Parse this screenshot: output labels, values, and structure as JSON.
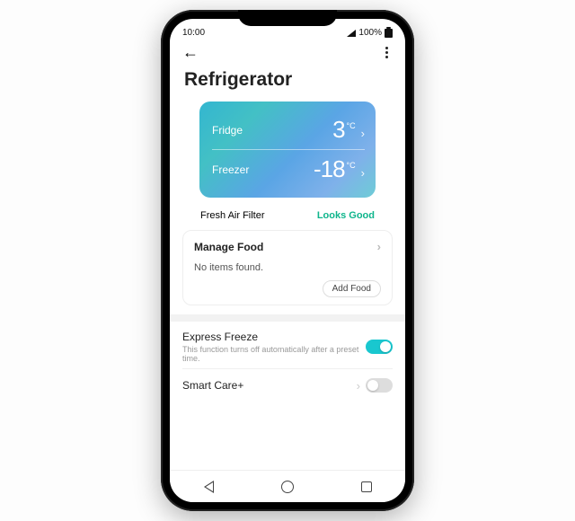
{
  "status": {
    "time": "10:00",
    "battery_pct": "100%"
  },
  "page": {
    "title": "Refrigerator"
  },
  "temps": {
    "fridge_label": "Fridge",
    "fridge_value": "3",
    "fridge_unit": "°C",
    "freezer_label": "Freezer",
    "freezer_value": "-18",
    "freezer_unit": "°C"
  },
  "filter": {
    "label": "Fresh Air Filter",
    "status": "Looks Good"
  },
  "food": {
    "heading": "Manage Food",
    "empty_text": "No items found.",
    "add_label": "Add Food"
  },
  "settings": {
    "express": {
      "name": "Express Freeze",
      "desc": "This function turns off automatically after a preset time.",
      "on": true
    },
    "smartcare": {
      "name": "Smart Care+",
      "on": false
    }
  }
}
